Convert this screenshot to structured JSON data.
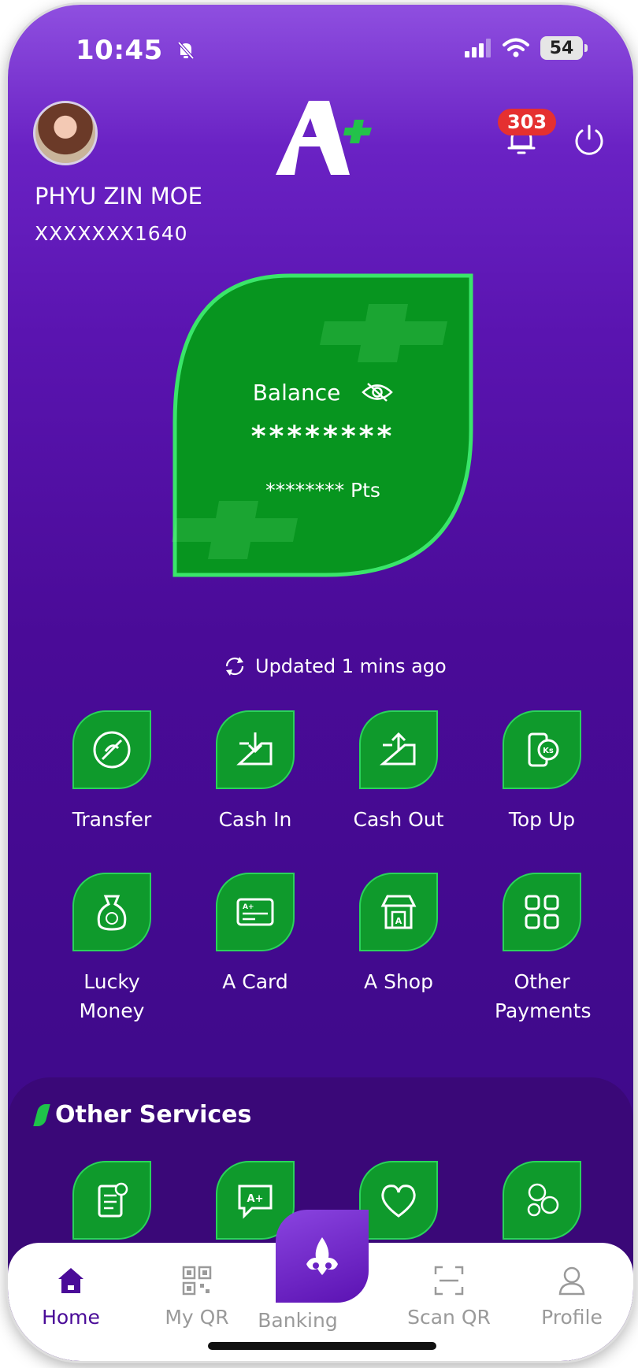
{
  "status_bar": {
    "time": "10:45",
    "battery": "54"
  },
  "header": {
    "user_name": "PHYU ZIN MOE",
    "user_phone": "XXXXXXX1640",
    "notification_count": "303"
  },
  "balance": {
    "label": "Balance",
    "value": "********",
    "points": "******** Pts"
  },
  "updated_text": "Updated 1 mins ago",
  "quick_actions": [
    {
      "label": "Transfer",
      "icon": "transfer-icon"
    },
    {
      "label": "Cash In",
      "icon": "cash-in-icon"
    },
    {
      "label": "Cash Out",
      "icon": "cash-out-icon"
    },
    {
      "label": "Top Up",
      "icon": "top-up-icon"
    },
    {
      "label": "Lucky Money",
      "icon": "lucky-money-icon"
    },
    {
      "label": "A Card",
      "icon": "a-card-icon"
    },
    {
      "label": "A Shop",
      "icon": "a-shop-icon"
    },
    {
      "label": "Other Payments",
      "icon": "other-payments-icon"
    }
  ],
  "other_services": {
    "title": "Other Services",
    "icons": [
      "bill-icon",
      "chat-icon",
      "heart-icon",
      "coins-icon"
    ]
  },
  "nav": [
    {
      "label": "Home",
      "icon": "home-icon",
      "active": true
    },
    {
      "label": "My QR",
      "icon": "qr-icon"
    },
    {
      "label": "Banking",
      "icon": "banking-icon"
    },
    {
      "label": "Scan QR",
      "icon": "scan-icon"
    },
    {
      "label": "Profile",
      "icon": "profile-icon"
    }
  ],
  "colors": {
    "brand_purple": "#4a0b98",
    "brand_green": "#0f9a2c",
    "badge_red": "#e53030"
  }
}
